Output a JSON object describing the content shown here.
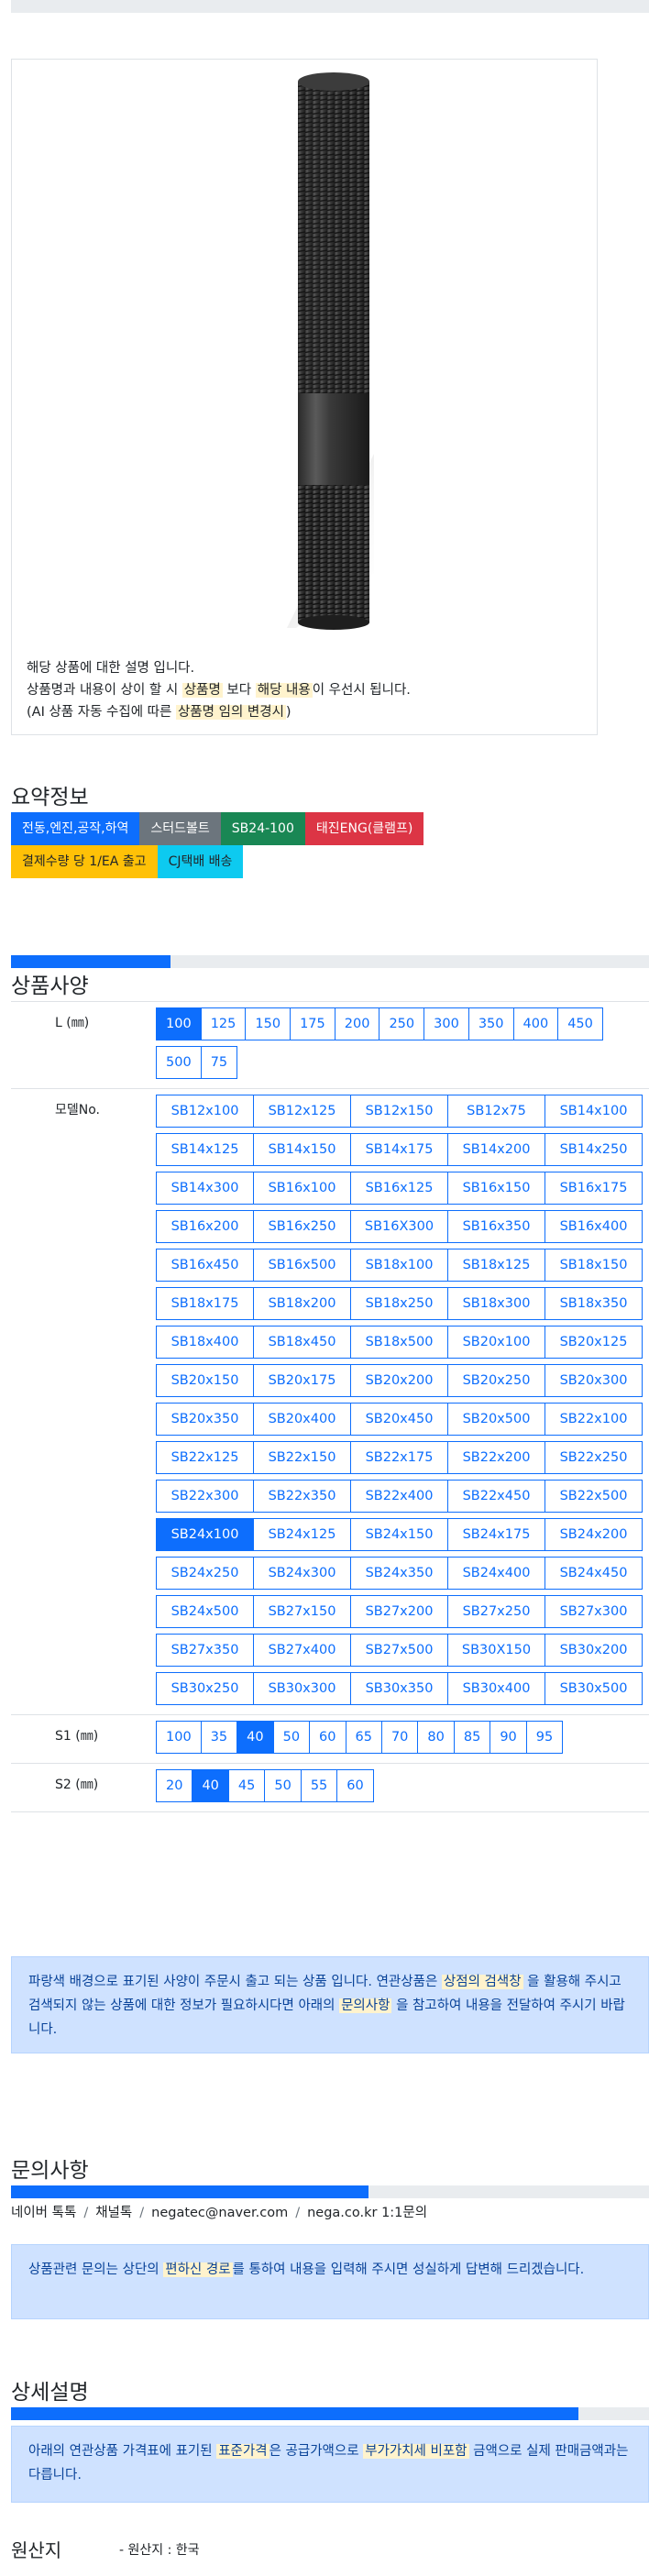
{
  "product": {
    "image_name": "stud-bolt-photo",
    "desc_line1": "해당 상품에 대한 설명 입니다.",
    "desc_line2_pre": "상품명과 내용이 상이 할 시 ",
    "desc_line2_hl1": "상품명",
    "desc_line2_mid": " 보다 ",
    "desc_line2_hl2": "해당 내용",
    "desc_line2_post": "이 우선시 됩니다.",
    "desc_line3_pre": "(AI 상품 자동 수집에 따른 ",
    "desc_line3_hl": "상품명 임의 변경시",
    "desc_line3_post": ")"
  },
  "summary": {
    "title": "요약정보",
    "badges_row1": [
      {
        "label": "전동,엔진,공작,하역",
        "color": "blue"
      },
      {
        "label": "스터드볼트",
        "color": "gray"
      },
      {
        "label": "SB24-100",
        "color": "green"
      },
      {
        "label": "태진ENG(클램프)",
        "color": "red"
      }
    ],
    "badges_row2": [
      {
        "label": "결제수량 당 1/EA 출고",
        "color": "yellow"
      },
      {
        "label": "CJ택배 배송",
        "color": "cyan"
      }
    ]
  },
  "spec": {
    "title": "상품사양",
    "progress_fraction": 0.25,
    "rows": [
      {
        "label": "L (㎜)",
        "options": [
          "100",
          "125",
          "150",
          "175",
          "200",
          "250",
          "300",
          "350",
          "400",
          "450",
          "500",
          "75"
        ],
        "selected": "100"
      },
      {
        "label": "모델No.",
        "options": [
          "SB12x100",
          "SB12x125",
          "SB12x150",
          "SB12x75",
          "SB14x100",
          "SB14x125",
          "SB14x150",
          "SB14x175",
          "SB14x200",
          "SB14x250",
          "SB14x300",
          "SB16x100",
          "SB16x125",
          "SB16x150",
          "SB16x175",
          "SB16x200",
          "SB16x250",
          "SB16X300",
          "SB16x350",
          "SB16x400",
          "SB16x450",
          "SB16x500",
          "SB18x100",
          "SB18x125",
          "SB18x150",
          "SB18x175",
          "SB18x200",
          "SB18x250",
          "SB18x300",
          "SB18x350",
          "SB18x400",
          "SB18x450",
          "SB18x500",
          "SB20x100",
          "SB20x125",
          "SB20x150",
          "SB20x175",
          "SB20x200",
          "SB20x250",
          "SB20x300",
          "SB20x350",
          "SB20x400",
          "SB20x450",
          "SB20x500",
          "SB22x100",
          "SB22x125",
          "SB22x150",
          "SB22x175",
          "SB22x200",
          "SB22x250",
          "SB22x300",
          "SB22x350",
          "SB22x400",
          "SB22x450",
          "SB22x500",
          "SB24x100",
          "SB24x125",
          "SB24x150",
          "SB24x175",
          "SB24x200",
          "SB24x250",
          "SB24x300",
          "SB24x350",
          "SB24x400",
          "SB24x450",
          "SB24x500",
          "SB27x150",
          "SB27x200",
          "SB27x250",
          "SB27x300",
          "SB27x350",
          "SB27x400",
          "SB27x500",
          "SB30X150",
          "SB30x200",
          "SB30x250",
          "SB30x300",
          "SB30x350",
          "SB30x400",
          "SB30x500"
        ],
        "selected": "SB24x100"
      },
      {
        "label": "S1 (㎜)",
        "options": [
          "100",
          "35",
          "40",
          "50",
          "60",
          "65",
          "70",
          "80",
          "85",
          "90",
          "95"
        ],
        "selected": "40"
      },
      {
        "label": "S2 (㎜)",
        "options": [
          "20",
          "40",
          "45",
          "50",
          "55",
          "60"
        ],
        "selected": "40"
      }
    ],
    "notice_pre": "파랑색 배경으로 표기된 사양이 주문시 출고 되는 상품 입니다. 연관상품은 ",
    "notice_hl1": "상점의 검색창",
    "notice_mid": " 을 활용해 주시고 검색되지 않는 상품에 대한 정보가 필요하시다면 아래의 ",
    "notice_hl2": "문의사항",
    "notice_post": " 을 참고하여 내용을 전달하여 주시기 바랍니다."
  },
  "inquiry": {
    "title": "문의사항",
    "progress_fraction": 0.56,
    "links": [
      "네이버 톡톡",
      "채널톡",
      "negatec@naver.com",
      "nega.co.kr 1:1문의"
    ],
    "notice_pre": "상품관련 문의는 상단의 ",
    "notice_hl": "편하신 경로",
    "notice_post": "를 통하여 내용을 입력해 주시면 성실하게 답변해 드리겠습니다."
  },
  "detail": {
    "title": "상세설명",
    "progress_fraction": 0.89,
    "notice_pre": "아래의 연관상품 가격표에 표기된 ",
    "notice_hl1": "표준가격",
    "notice_mid": "은 공급가액으로 ",
    "notice_hl2": "부가가치세 비포함",
    "notice_post": " 금액으로 실제 판매금액과는 다릅니다."
  },
  "origin": {
    "label": "원산지",
    "value": "- 원산지 : 한국"
  }
}
